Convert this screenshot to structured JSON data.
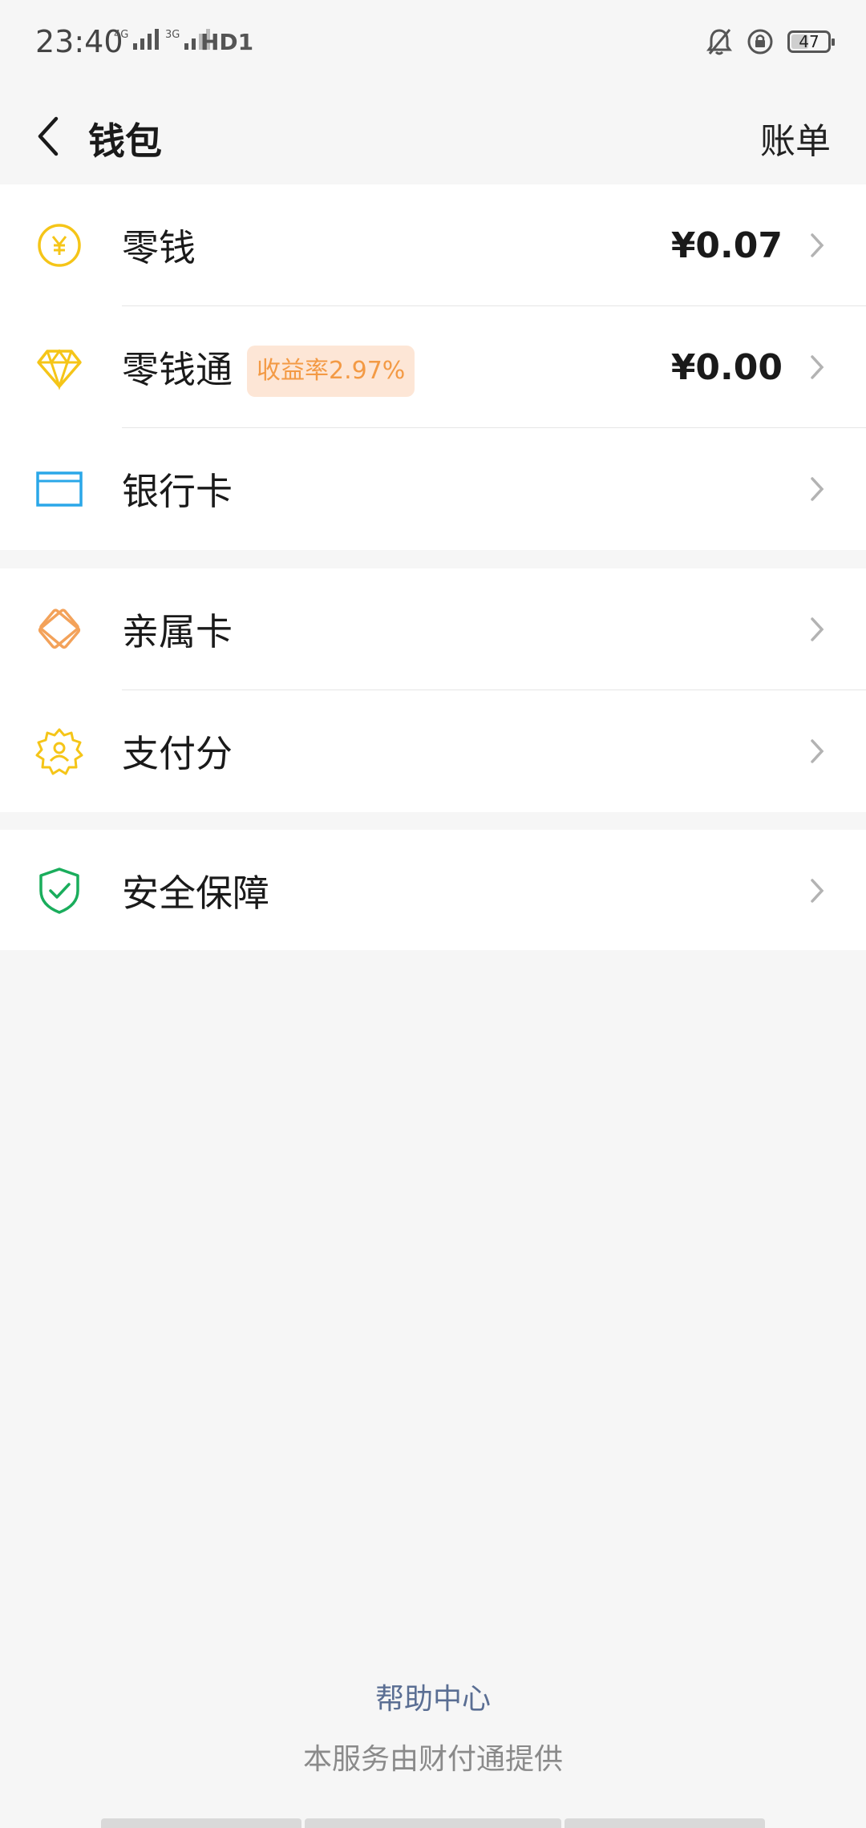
{
  "status_bar": {
    "time": "23:40",
    "signal1_label": "4G",
    "signal2_label": "3G",
    "hd_label": "HD1",
    "battery": "47"
  },
  "header": {
    "title": "钱包",
    "bill": "账单"
  },
  "groups": [
    {
      "items": [
        {
          "label": "零钱",
          "value": "¥0.07",
          "icon": "yuan-coin-icon",
          "color": "#f5c518"
        },
        {
          "label": "零钱通",
          "badge": "收益率2.97%",
          "value": "¥0.00",
          "icon": "diamond-icon",
          "color": "#f5c518"
        },
        {
          "label": "银行卡",
          "icon": "bank-card-icon",
          "color": "#2aa7e8"
        }
      ]
    },
    {
      "items": [
        {
          "label": "亲属卡",
          "icon": "family-card-icon",
          "color": "#f3a25a"
        },
        {
          "label": "支付分",
          "icon": "pay-score-icon",
          "color": "#f5c518"
        }
      ]
    },
    {
      "items": [
        {
          "label": "安全保障",
          "icon": "security-shield-icon",
          "color": "#1aad5c"
        }
      ]
    }
  ],
  "footer": {
    "help": "帮助中心",
    "provider": "本服务由财付通提供"
  },
  "colors": {
    "background": "#f6f6f6",
    "badge_bg": "#fde6d6",
    "badge_text": "#f39a45",
    "link": "#5a6e93"
  }
}
